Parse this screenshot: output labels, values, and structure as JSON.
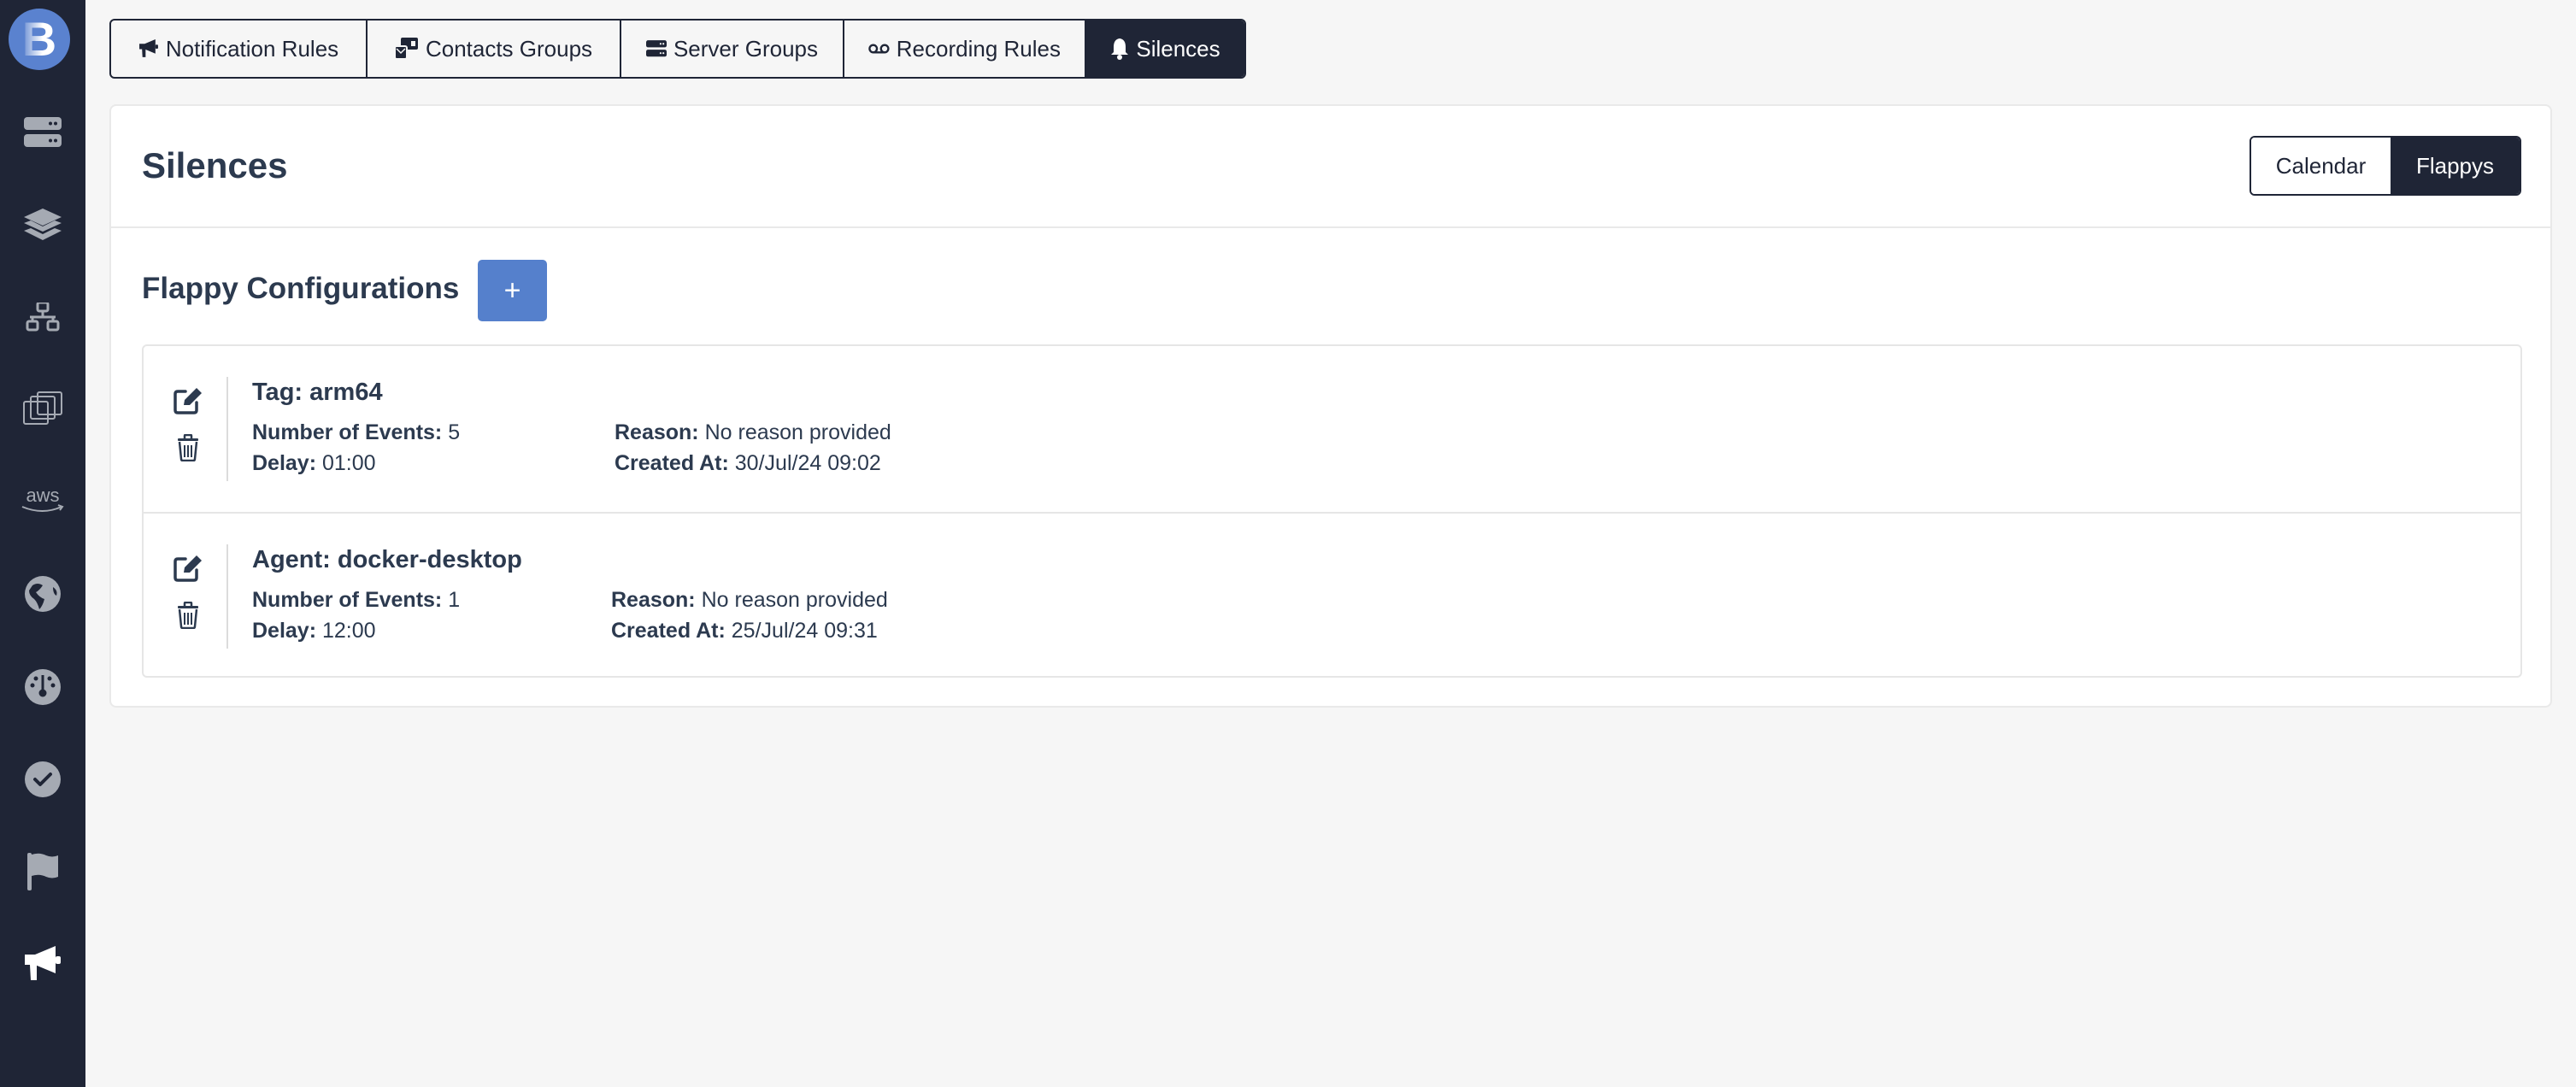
{
  "sidebar": {
    "logo_letter": "B",
    "items": [
      {
        "name": "servers",
        "icon": "server-icon",
        "active": false
      },
      {
        "name": "layers",
        "icon": "layers-icon",
        "active": false
      },
      {
        "name": "network",
        "icon": "network-icon",
        "active": false
      },
      {
        "name": "virtual-machines",
        "icon": "windows-stack-icon",
        "active": false
      },
      {
        "name": "aws",
        "icon": "aws-icon",
        "active": false
      },
      {
        "name": "web",
        "icon": "globe-icon",
        "active": false
      },
      {
        "name": "dashboard",
        "icon": "gauge-icon",
        "active": false
      },
      {
        "name": "checks",
        "icon": "check-circle-icon",
        "active": false
      },
      {
        "name": "flags",
        "icon": "flag-icon",
        "active": false
      },
      {
        "name": "notifications",
        "icon": "bullhorn-icon",
        "active": true
      }
    ]
  },
  "tabs": [
    {
      "label": "Notification Rules",
      "icon": "bullhorn-icon",
      "active": false
    },
    {
      "label": "Contacts Groups",
      "icon": "contacts-icon",
      "active": false
    },
    {
      "label": "Server Groups",
      "icon": "server-icon",
      "active": false
    },
    {
      "label": "Recording Rules",
      "icon": "voicemail-icon",
      "active": false
    },
    {
      "label": "Silences",
      "icon": "bell-icon",
      "active": true
    }
  ],
  "page": {
    "title": "Silences",
    "view_toggle": {
      "options": [
        "Calendar",
        "Flappys"
      ],
      "selected": "Flappys"
    }
  },
  "flappy": {
    "section_title": "Flappy Configurations",
    "add_label": "+",
    "labels": {
      "events": "Number of Events:",
      "delay": "Delay:",
      "reason": "Reason:",
      "created": "Created At:"
    },
    "items": [
      {
        "title": "Tag: arm64",
        "events": "5",
        "delay": "01:00",
        "reason": "No reason provided",
        "created": "30/Jul/24 09:02"
      },
      {
        "title": "Agent: docker-desktop",
        "events": "1",
        "delay": "12:00",
        "reason": "No reason provided",
        "created": "25/Jul/24 09:31"
      }
    ]
  },
  "colors": {
    "sidebar_bg": "#1f2536",
    "icon_muted": "#a5aab3",
    "accent": "#5580cc",
    "text": "#2c3a4f"
  }
}
